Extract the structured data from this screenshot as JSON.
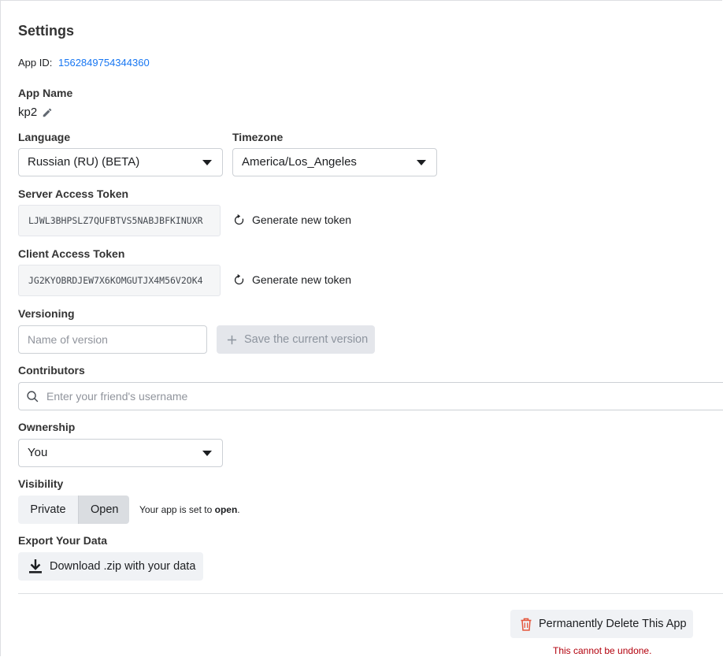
{
  "settings": {
    "title": "Settings",
    "app_id_label": "App ID:",
    "app_id": "1562849754344360",
    "app_name_label": "App Name",
    "app_name": "kp2",
    "language_label": "Language",
    "language_value": "Russian (RU) (BETA)",
    "timezone_label": "Timezone",
    "timezone_value": "America/Los_Angeles",
    "server_token_label": "Server Access Token",
    "server_token": "LJWL3BHPSLZ7QUFBTVS5NABJBFKINUXR",
    "client_token_label": "Client Access Token",
    "client_token": "JG2KYOBRDJEW7X6KOMGUTJX4M56V2OK4",
    "generate_label": "Generate new token",
    "versioning_label": "Versioning",
    "version_placeholder": "Name of version",
    "save_version_label": "Save the current version",
    "contributors_label": "Contributors",
    "contributors_placeholder": "Enter your friend's username",
    "ownership_label": "Ownership",
    "ownership_value": "You",
    "visibility_label": "Visibility",
    "visibility_private": "Private",
    "visibility_open": "Open",
    "visibility_note_prefix": "Your app is set to ",
    "visibility_note_value": "open",
    "visibility_note_suffix": ".",
    "export_label": "Export Your Data",
    "download_label": "Download .zip with your data",
    "delete_label": "Permanently Delete This App",
    "delete_warning": "This cannot be undone."
  },
  "colors": {
    "link": "#1877f2",
    "danger": "#b3000c",
    "trash": "#e4573d"
  },
  "icons": {
    "edit": "pencil-icon",
    "refresh": "refresh-icon",
    "search": "search-icon",
    "plus": "plus-icon",
    "download": "download-icon",
    "trash": "trash-icon",
    "dropdown": "chevron-down-icon"
  }
}
